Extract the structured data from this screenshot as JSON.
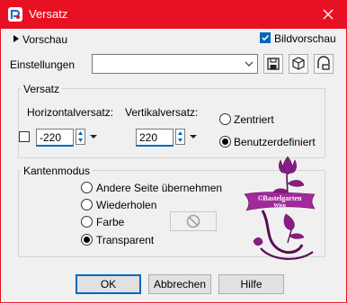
{
  "window": {
    "title": "Versatz",
    "accent": "#e81123"
  },
  "header": {
    "vorschau_label": "Vorschau",
    "bildvorschau_label": "Bildvorschau",
    "bildvorschau_checked": true,
    "einstellungen_label": "Einstellungen",
    "einstellungen_value": ""
  },
  "versatz": {
    "group_label": "Versatz",
    "horizontal_label": "Horizontalversatz:",
    "horizontal_value": "-220",
    "vertikal_label": "Vertikalversatz:",
    "vertikal_value": "220",
    "zentriert_label": "Zentriert",
    "benutzer_label": "Benutzerdefiniert",
    "selected": "Benutzerdefiniert"
  },
  "kanten": {
    "group_label": "Kantenmodus",
    "options": [
      "Andere Seite übernehmen",
      "Wiederholen",
      "Farbe",
      "Transparent"
    ],
    "selected": "Transparent"
  },
  "watermark": {
    "text_line1": "©Bastelgarten",
    "text_line2": "Wien"
  },
  "buttons": {
    "ok": "OK",
    "cancel": "Abbrechen",
    "help": "Hilfe"
  }
}
